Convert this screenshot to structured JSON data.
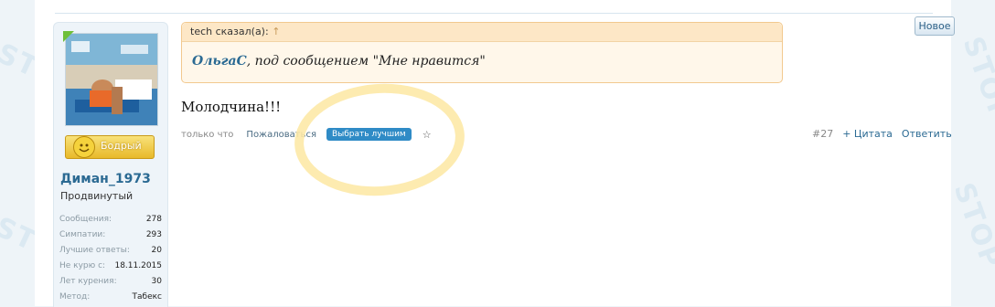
{
  "sidebar": {
    "mood_label": "Бодрый",
    "username": "Диман_1973",
    "rank": "Продвинутый",
    "stats": [
      {
        "name": "Сообщения:",
        "value": "278"
      },
      {
        "name": "Симпатии:",
        "value": "293"
      },
      {
        "name": "Лучшие ответы:",
        "value": "20"
      },
      {
        "name": "Не курю с:",
        "value": "18.11.2015"
      },
      {
        "name": "Лет курения:",
        "value": "30"
      },
      {
        "name": "Метод:",
        "value": "Табекс"
      }
    ]
  },
  "quote": {
    "header_text": "tech сказал(а): ",
    "header_arrow": "↑",
    "author": "ОльгаС",
    "text": ", под сообщением \"Мне нравится\""
  },
  "post": {
    "message": "Молодчина!!!",
    "time": "только что",
    "report_label": "Пожаловаться",
    "best_label": "Выбрать лучшим",
    "star": "☆",
    "post_number": "#27",
    "quote_label": "+ Цитата",
    "reply_label": "Ответить"
  },
  "badge": {
    "new_label": "Новое"
  },
  "watermark": {
    "text": "STOP"
  },
  "colors": {
    "link": "#2b6a93",
    "accent_button": "#2f8bc6",
    "quote_border": "#f2c98f",
    "highlight_circle": "#fde9a7"
  }
}
